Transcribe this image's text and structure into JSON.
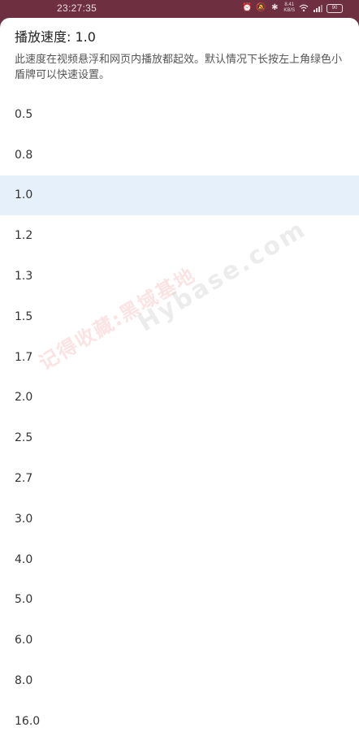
{
  "status_bar": {
    "time": "23:27:35",
    "net_speed_value": "8.41",
    "net_speed_unit": "KB/S",
    "battery": "90",
    "icons": [
      "alarm-icon",
      "bell-off-icon",
      "bluetooth-icon",
      "wifi-icon",
      "signal-icon",
      "battery-icon"
    ]
  },
  "dialog": {
    "title": "播放速度: 1.0",
    "description": "此速度在视频悬浮和网页内播放都起效。默认情况下长按左上角绿色小盾牌可以快速设置。",
    "selected": "1.0",
    "options": [
      "0.5",
      "0.8",
      "1.0",
      "1.2",
      "1.3",
      "1.5",
      "1.7",
      "2.0",
      "2.5",
      "2.7",
      "3.0",
      "4.0",
      "5.0",
      "6.0",
      "8.0",
      "16.0"
    ]
  },
  "watermark": {
    "cn": "记得收藏:黑域基地",
    "en": "Hybase.com"
  },
  "colors": {
    "status_bar_bg": "#6e3040",
    "selected_bg": "#e6f0fa"
  }
}
